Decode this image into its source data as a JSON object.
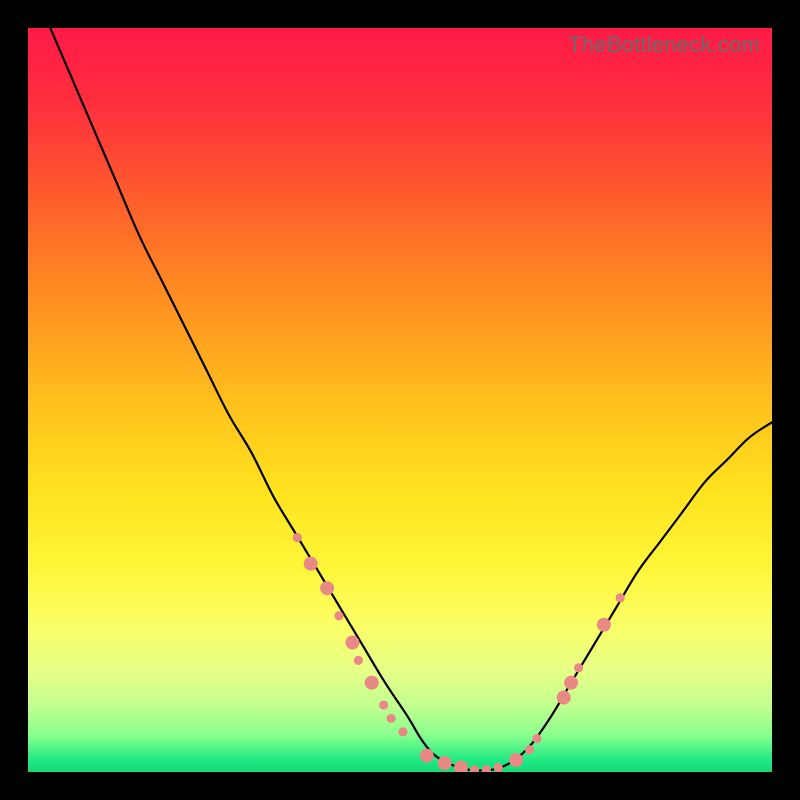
{
  "watermark": "TheBottleneck.com",
  "gradient_stops": [
    {
      "offset": 0.0,
      "color": "#ff1a47"
    },
    {
      "offset": 0.1,
      "color": "#ff2e3e"
    },
    {
      "offset": 0.22,
      "color": "#ff5a2d"
    },
    {
      "offset": 0.35,
      "color": "#ff8a22"
    },
    {
      "offset": 0.5,
      "color": "#ffbf1c"
    },
    {
      "offset": 0.62,
      "color": "#ffe21e"
    },
    {
      "offset": 0.72,
      "color": "#fff537"
    },
    {
      "offset": 0.8,
      "color": "#fbff64"
    },
    {
      "offset": 0.86,
      "color": "#e8ff86"
    },
    {
      "offset": 0.91,
      "color": "#c3ff8f"
    },
    {
      "offset": 0.95,
      "color": "#8aff8f"
    },
    {
      "offset": 0.985,
      "color": "#1de982"
    },
    {
      "offset": 1.0,
      "color": "#16d878"
    }
  ],
  "chart_data": {
    "type": "line",
    "title": "",
    "xlabel": "",
    "ylabel": "",
    "xlim": [
      0,
      100
    ],
    "ylim": [
      0,
      100
    ],
    "series": [
      {
        "name": "curve",
        "color": "#000000",
        "x": [
          3,
          6,
          9,
          12,
          15,
          18,
          21,
          24,
          27,
          30,
          33,
          36,
          39,
          42,
          45,
          48,
          51,
          53,
          55,
          58,
          61,
          64,
          67,
          70,
          73,
          76,
          79,
          82,
          85,
          88,
          91,
          94,
          97,
          100
        ],
        "y": [
          100,
          93,
          86,
          79,
          72,
          66,
          60,
          54,
          48,
          43,
          37,
          32,
          27,
          22,
          17,
          12,
          7.5,
          4.2,
          2.0,
          0.6,
          0.2,
          0.8,
          3.0,
          7.0,
          12,
          17,
          22,
          27,
          31,
          35,
          39,
          42,
          45,
          47
        ]
      }
    ],
    "marker_points": {
      "color": "#e98986",
      "radius_small": 4.6,
      "radius_large": 7,
      "points": [
        {
          "x": 36.2,
          "y": 31.5,
          "r": "small"
        },
        {
          "x": 38.0,
          "y": 28.0,
          "r": "large"
        },
        {
          "x": 40.2,
          "y": 24.7,
          "r": "large"
        },
        {
          "x": 41.8,
          "y": 21.0,
          "r": "small"
        },
        {
          "x": 43.6,
          "y": 17.4,
          "r": "large"
        },
        {
          "x": 44.4,
          "y": 15.0,
          "r": "small"
        },
        {
          "x": 46.2,
          "y": 12.0,
          "r": "large"
        },
        {
          "x": 47.8,
          "y": 9.0,
          "r": "small"
        },
        {
          "x": 48.8,
          "y": 7.2,
          "r": "small"
        },
        {
          "x": 50.4,
          "y": 5.4,
          "r": "small"
        },
        {
          "x": 53.6,
          "y": 2.2,
          "r": "large"
        },
        {
          "x": 56.0,
          "y": 1.2,
          "r": "large"
        },
        {
          "x": 58.2,
          "y": 0.6,
          "r": "large"
        },
        {
          "x": 60.0,
          "y": 0.3,
          "r": "small"
        },
        {
          "x": 61.6,
          "y": 0.3,
          "r": "small"
        },
        {
          "x": 63.2,
          "y": 0.6,
          "r": "small"
        },
        {
          "x": 65.6,
          "y": 1.6,
          "r": "large"
        },
        {
          "x": 67.4,
          "y": 3.0,
          "r": "small"
        },
        {
          "x": 68.4,
          "y": 4.5,
          "r": "small"
        },
        {
          "x": 72.0,
          "y": 10.0,
          "r": "large"
        },
        {
          "x": 73.0,
          "y": 12.0,
          "r": "large"
        },
        {
          "x": 74.0,
          "y": 14.0,
          "r": "small"
        },
        {
          "x": 77.4,
          "y": 19.8,
          "r": "large"
        },
        {
          "x": 79.6,
          "y": 23.4,
          "r": "small"
        }
      ]
    }
  }
}
